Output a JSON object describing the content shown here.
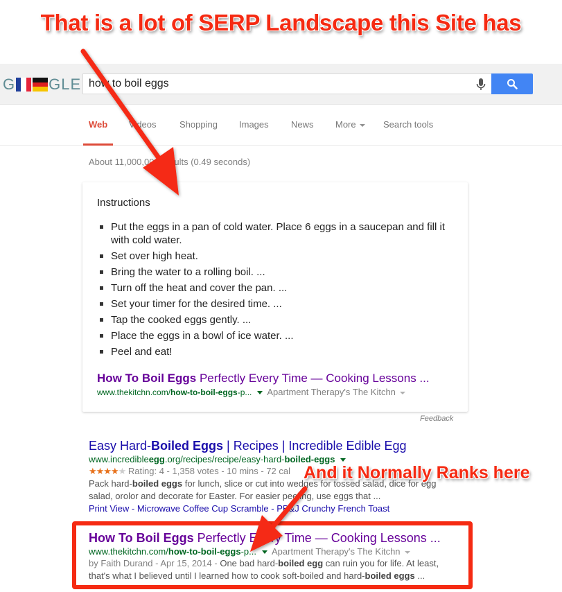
{
  "annotations": {
    "top_callout": "That is a lot of SERP Landscape this Site has",
    "bottom_callout": "And it Normally Ranks here",
    "color": "#f52a12"
  },
  "header": {
    "logo": {
      "prefix": "G",
      "suffix": "GLE",
      "flags": [
        "france-flag",
        "germany-flag"
      ]
    },
    "search": {
      "value": "how to boil eggs",
      "mic_icon": "microphone-icon",
      "search_icon": "magnifier-icon"
    }
  },
  "tabs": [
    {
      "label": "Web",
      "active": true
    },
    {
      "label": "Videos"
    },
    {
      "label": "Shopping"
    },
    {
      "label": "Images"
    },
    {
      "label": "News"
    },
    {
      "label": "More"
    },
    {
      "label": "Search tools"
    }
  ],
  "result_stats": "About 11,000,000 results (0.49 seconds)",
  "answer_box": {
    "heading": "Instructions",
    "steps": [
      "Put the eggs in a pan of cold water. Place 6 eggs in a saucepan and fill it with cold water.",
      "Set over high heat.",
      "Bring the water to a rolling boil. ...",
      "Turn off the heat and cover the pan. ...",
      "Set your timer for the desired time. ...",
      "Tap the cooked eggs gently. ...",
      "Place the eggs in a bowl of ice water. ...",
      "Peel and eat!"
    ],
    "source_title_bold": "How To Boil Eggs",
    "source_title_rest": " Perfectly Every Time — Cooking Lessons ...",
    "source_url_plain": "www.thekitchn.com/",
    "source_url_bold": "how-to-boil-eggs",
    "source_url_tail": "-p...",
    "source_site": "Apartment Therapy's The Kitchn",
    "feedback": "Feedback"
  },
  "results": [
    {
      "title_pre": "Easy Hard-",
      "title_bold": "Boiled Eggs",
      "title_post": " | Recipes | Incredible Edible Egg",
      "url_pre": "www.incredible",
      "url_bold1": "egg",
      "url_mid": ".org/recipes/recipe/easy-hard-",
      "url_bold2": "boiled-eggs",
      "rating": {
        "stars": 4,
        "max": 5,
        "text": "Rating: 4 - 1,358 votes - 10 mins - 72 cal"
      },
      "snippet_pre": "Pack hard-",
      "snippet_bold": "boiled eggs",
      "snippet_post": " for lunch, slice or cut into wedges for tossed salad, dice for egg salad, orolor and decorate for Easter. For easier peeling, use eggs that ...",
      "sitelinks": [
        "Print View",
        "Microwave Coffee Cup Scramble",
        "PB&J Crunchy French Toast"
      ]
    },
    {
      "title_bold": "How To Boil Eggs",
      "title_post": " Perfectly Every Time — Cooking Lessons ...",
      "url_pre": "www.thekitchn.com/",
      "url_bold": "how-to-boil-eggs",
      "url_tail": "-p...",
      "site": "Apartment Therapy's The Kitchn",
      "meta": "by Faith Durand - Apr 15, 2014 - ",
      "snippet_a": "One bad hard-",
      "snippet_b": "boiled egg",
      "snippet_c": " can ruin you for life. At least, that's what I believed until I learned how to cook soft-boiled and hard-",
      "snippet_d": "boiled eggs",
      "snippet_e": " ..."
    }
  ]
}
